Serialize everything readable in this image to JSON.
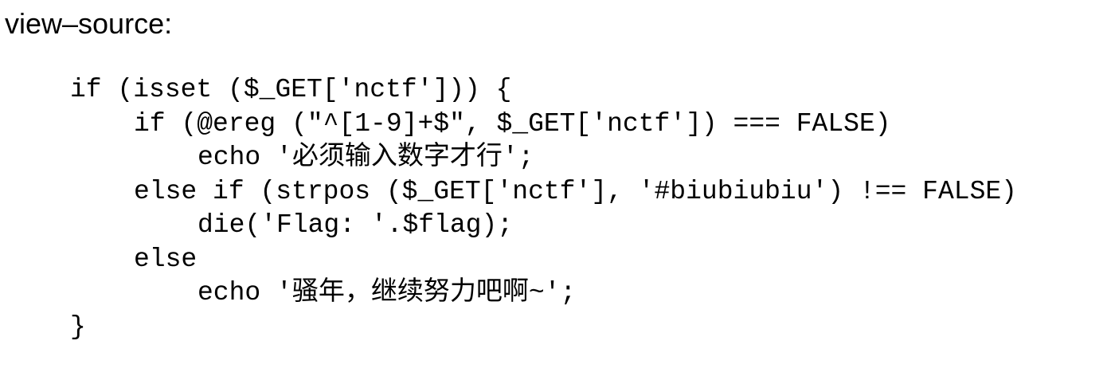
{
  "title": "view–source:",
  "code_lines": [
    "if (isset ($_GET['nctf'])) {",
    "if (@ereg (\"^[1-9]+$\", $_GET['nctf']) === FALSE)",
    "echo '必须输入数字才行';",
    "else if (strpos ($_GET['nctf'], '#biubiubiu') !== FALSE)",
    "die('Flag: '.$flag);",
    "else",
    "echo '骚年，继续努力吧啊~';",
    "}"
  ]
}
